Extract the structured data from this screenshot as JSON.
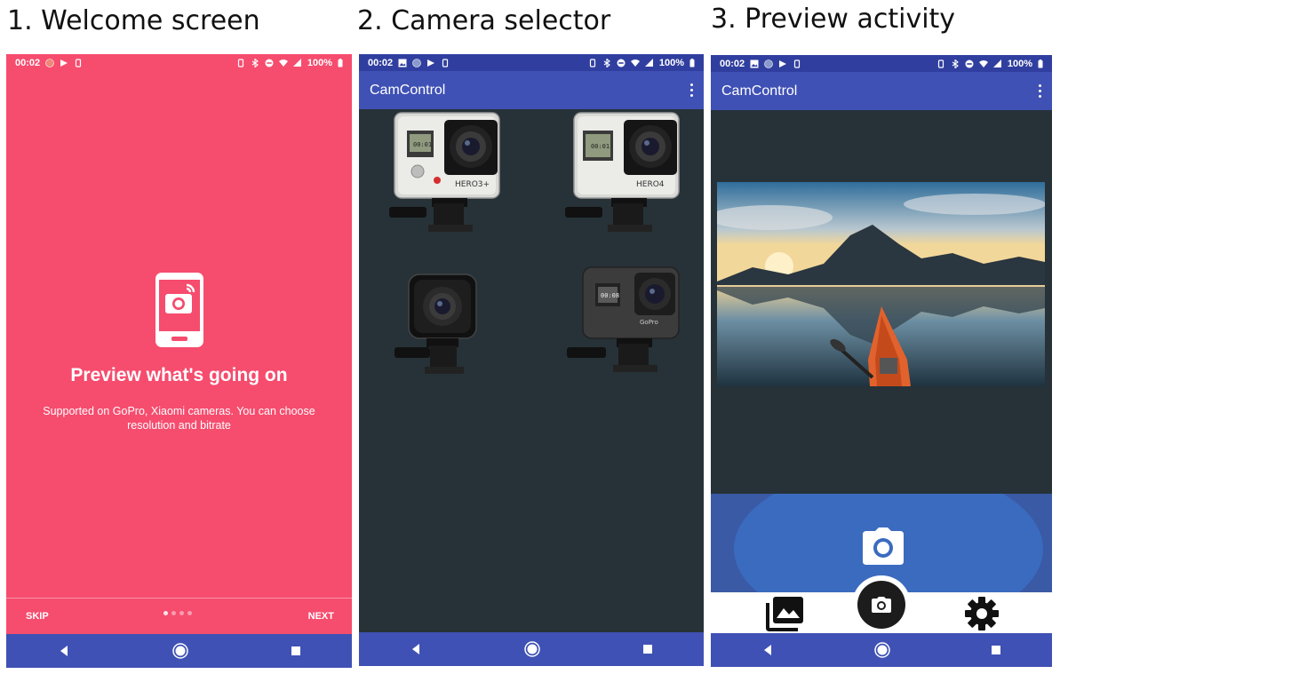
{
  "captions": {
    "screen1": "1. Welcome screen",
    "screen2": "2. Camera selector",
    "screen3": "3. Preview activity"
  },
  "status": {
    "time": "00:02",
    "battery": "100%"
  },
  "welcome": {
    "title": "Preview what's going on",
    "description": "Supported on GoPro, Xiaomi cameras. You can choose resolution and bitrate",
    "skip_label": "SKIP",
    "next_label": "NEXT",
    "page_count": 4,
    "current_page": 1
  },
  "app": {
    "title": "CamControl"
  },
  "cameras": [
    {
      "icon": "gopro-hero3plus-icon",
      "label": "HERO3+"
    },
    {
      "icon": "gopro-hero4-icon",
      "label": "HERO4"
    },
    {
      "icon": "gopro-session-icon",
      "label": ""
    },
    {
      "icon": "gopro-hero5-icon",
      "label": ""
    }
  ],
  "camera_screen_text": {
    "hero3_display": "00:01",
    "hero4_display": "00:01",
    "hero5_display": "00:08",
    "brand": "GoPro"
  },
  "preview": {
    "image": "lake-mountain-kayak-landscape",
    "bottom_icons": [
      "photo-library-icon",
      "camera-icon",
      "settings-icon"
    ]
  },
  "colors": {
    "welcome_bg": "#f64c6e",
    "primary": "#3f51b5",
    "primary_dark": "#303f9f",
    "dark_bg": "#263238"
  }
}
